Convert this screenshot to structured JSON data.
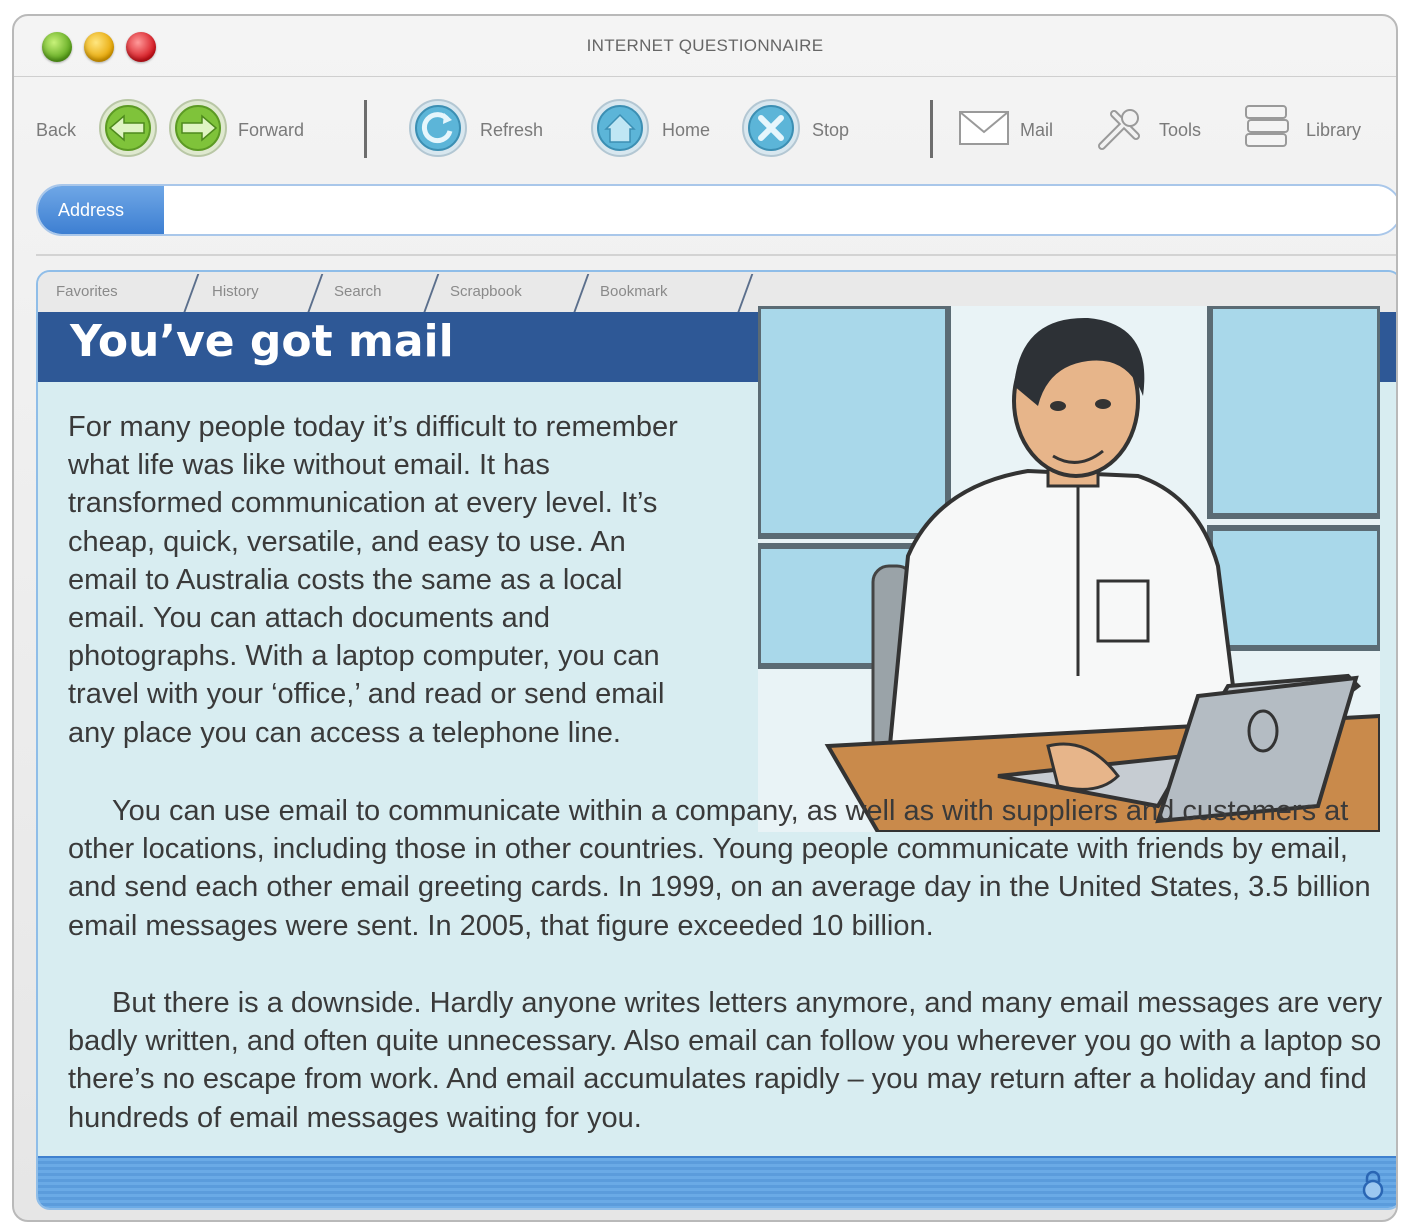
{
  "window": {
    "title": "INTERNET QUESTIONNAIRE"
  },
  "toolbar": {
    "back": "Back",
    "forward": "Forward",
    "refresh": "Refresh",
    "home": "Home",
    "stop": "Stop",
    "mail": "Mail",
    "tools": "Tools",
    "library": "Library"
  },
  "address": {
    "label": "Address",
    "value": ""
  },
  "tabs": [
    "Favorites",
    "History",
    "Search",
    "Scrapbook",
    "Bookmark"
  ],
  "article": {
    "heading": "You’ve got mail",
    "paragraph1": "For many people today it’s difficult to remember what life was like without email. It has transformed communication at every level. It’s cheap, quick, versatile, and easy to use. An email to Australia costs the same as a local email. You can attach documents and photographs. With a laptop computer, you can travel with your ‘office,’ and read or send email any place you can access a telephone line.",
    "paragraph2": "You can use email to communicate within a company, as well as with suppliers and customers at other locations, including those in other countries. Young people communicate with friends by email, and send each other email greeting cards. In 1999, on an average day in the United States, 3.5 billion email messages were sent. In 2005, that figure exceeded 10 billion.",
    "paragraph3": "But there is a downside. Hardly anyone writes letters anymore, and many email messages are very badly written, and often quite unnecessary. Also email can follow you wherever you go with a laptop so there’s no escape from work. And email accumulates rapidly – you may return after a holiday and find hundreds of email messages waiting for you."
  },
  "icons": {
    "traffic_lights": [
      "green-light-icon",
      "yellow-light-icon",
      "red-light-icon"
    ],
    "toolbar": [
      "back-arrow-icon",
      "forward-arrow-icon",
      "refresh-icon",
      "home-icon",
      "stop-icon",
      "mail-icon",
      "tools-icon",
      "library-icon"
    ],
    "status": "lock-icon"
  },
  "colors": {
    "heading_band": "#2e5896",
    "content_bg": "#d8edf1",
    "address_label": "#3d7fd2",
    "light_green": "#5aa51a",
    "light_yellow": "#e6a400",
    "light_red": "#d3121b"
  }
}
